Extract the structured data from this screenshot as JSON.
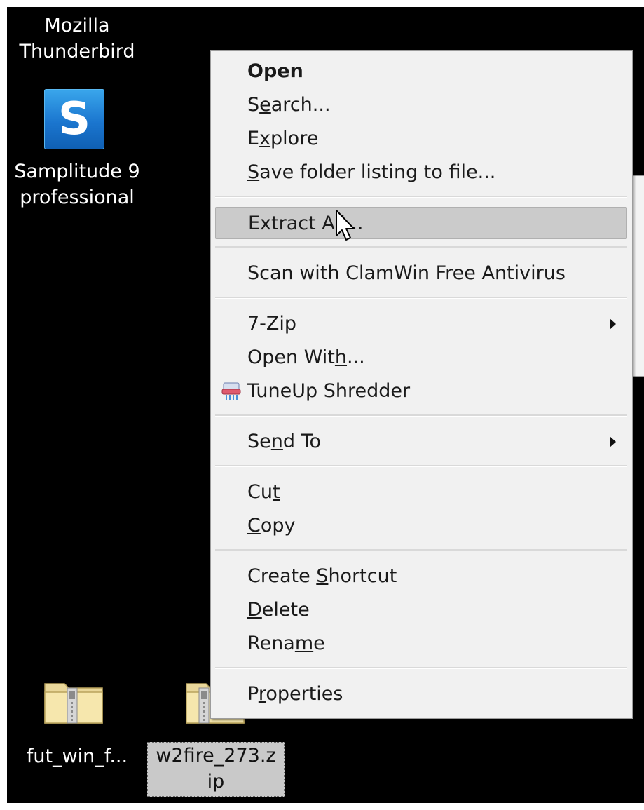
{
  "desktop": {
    "icons": [
      {
        "label": "Mozilla Thunderbird"
      },
      {
        "label_line1": "Samplitude 9",
        "label_line2": "professional",
        "icon_letter": "S"
      },
      {
        "label": "fut_win_f..."
      },
      {
        "label_line1": "w2fire_273.z",
        "label_line2": "ip"
      }
    ],
    "accent_color": "#1b76cf"
  },
  "context_menu": {
    "items": [
      {
        "label": "Open",
        "bold": true
      },
      {
        "label": "Search...",
        "underline_index": 1
      },
      {
        "label": "Explore",
        "underline_index": 1
      },
      {
        "label": "Save folder listing to file...",
        "underline_index": 0
      },
      {
        "label": "Extract All...",
        "highlighted": true
      },
      {
        "label": "Scan with ClamWin Free Antivirus"
      },
      {
        "label": "7-Zip",
        "submenu": true
      },
      {
        "label": "Open With...",
        "underline_index": 8
      },
      {
        "label": "TuneUp Shredder",
        "icon": "shredder-icon"
      },
      {
        "label": "Send To",
        "submenu": true,
        "underline_index": 2
      },
      {
        "label": "Cut",
        "underline_index": 2
      },
      {
        "label": "Copy",
        "underline_index": 0
      },
      {
        "label": "Create Shortcut",
        "underline_index": 7
      },
      {
        "label": "Delete",
        "underline_index": 0
      },
      {
        "label": "Rename",
        "underline_index": 4
      },
      {
        "label": "Properties",
        "underline_index": 1
      }
    ],
    "highlight_color": "#cbcbcb",
    "background_color": "#f1f1f1"
  }
}
